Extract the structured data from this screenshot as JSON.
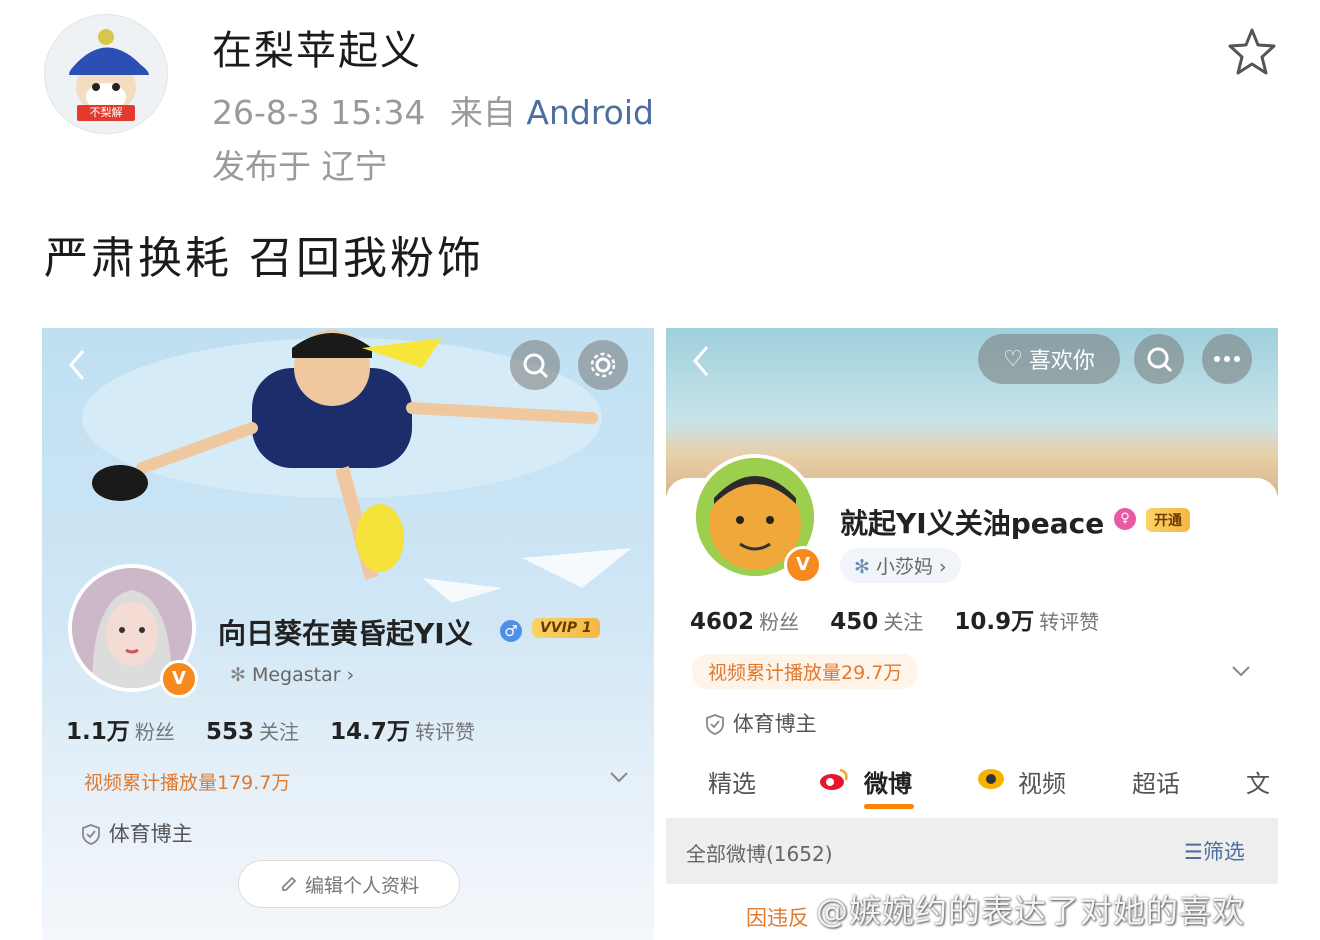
{
  "post": {
    "author": "在梨苹起义",
    "avatar_badge": "不梨解",
    "time": "26-8-3 15:34",
    "source_prefix": "来自",
    "source": "Android",
    "location": "发布于 辽宁",
    "text": "严肃换耗  召回我粉饰"
  },
  "left_profile": {
    "name": "向日葵在黄昏起YI义",
    "vip": "VVIP 1",
    "tag": "Megastar",
    "fans_num": "1.1万",
    "fans_lbl": "粉丝",
    "follow_num": "553",
    "follow_lbl": "关注",
    "likes_num": "14.7万",
    "likes_lbl": "转评赞",
    "video_plays": "视频累计播放量179.7万",
    "category": "体育博主",
    "edit_button": "编辑个人资料"
  },
  "right_profile": {
    "like_you": "喜欢你",
    "name": "就起YI义关油peace",
    "open_badge": "开通",
    "tag": "小莎妈",
    "fans_num": "4602",
    "fans_lbl": "粉丝",
    "follow_num": "450",
    "follow_lbl": "关注",
    "likes_num": "10.9万",
    "likes_lbl": "转评赞",
    "video_plays": "视频累计播放量29.7万",
    "category": "体育博主",
    "tabs": [
      "精选",
      "微博",
      "视频",
      "超话",
      "文"
    ],
    "all_posts": "全部微博(1652)",
    "filter": "筛选",
    "bottom_text": "因违反"
  },
  "watermark": "@嫉婉约的表达了对她的喜欢",
  "colors": {
    "accent_orange": "#e07a2e",
    "source_blue": "#4d6fa0",
    "vip_gold": "#f5b642"
  },
  "icons": [
    "star-icon",
    "back-icon",
    "search-icon",
    "gear-icon",
    "more-icon",
    "snowflake-icon",
    "shield-icon",
    "chevron-down-icon",
    "pencil-icon",
    "filter-icon",
    "weibo-icon",
    "video-icon"
  ]
}
